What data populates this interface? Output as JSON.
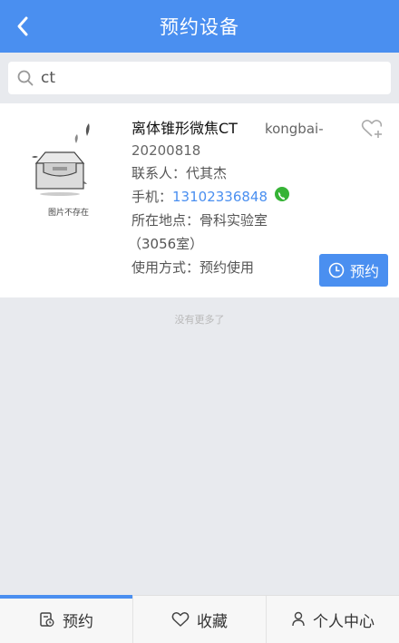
{
  "header": {
    "title": "预约设备"
  },
  "search": {
    "value": "ct"
  },
  "device": {
    "thumb_caption": "图片不存在",
    "name": "离体锥形微焦CT",
    "owner": "kongbai-",
    "date": "20200818",
    "contact_label": "联系人：",
    "contact_value": "代其杰",
    "phone_label": "手机：",
    "phone_value": "13102336848",
    "location_label": "所在地点：",
    "location_value": "骨科实验室",
    "location_room": "（3056室）",
    "usage_label": "使用方式：",
    "usage_value": "预约使用",
    "book_label": "预约"
  },
  "no_more": "没有更多了",
  "tabs": [
    {
      "label": "预约",
      "icon": "calendar-icon",
      "active": true
    },
    {
      "label": "收藏",
      "icon": "heart-icon"
    },
    {
      "label": "个人中心",
      "icon": "person-icon"
    }
  ],
  "colors": {
    "accent": "#4a8ff0",
    "phone_icon": "#36b336"
  }
}
